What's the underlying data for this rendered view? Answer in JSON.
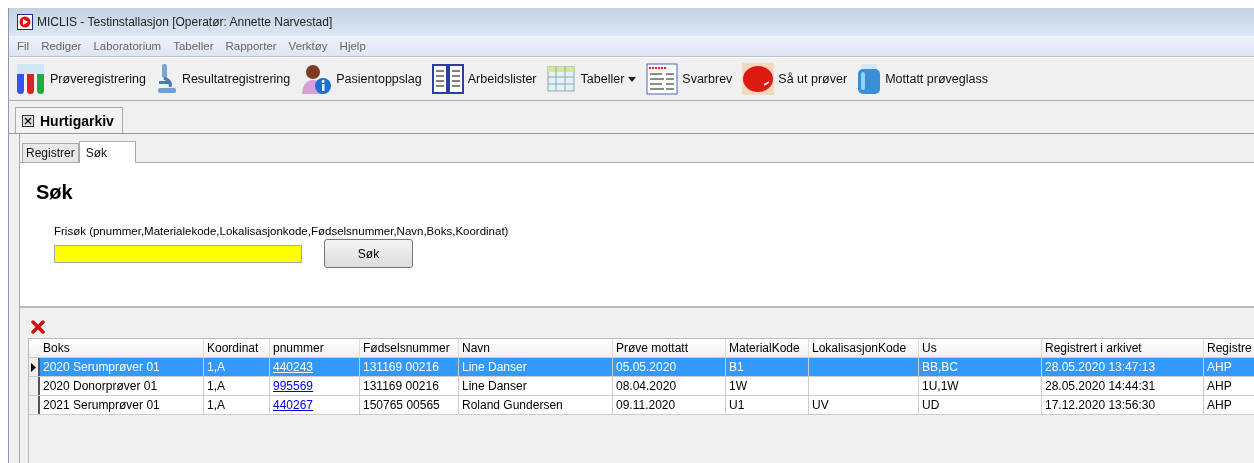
{
  "window": {
    "title": "MICLIS - Testinstallasjon [Operatør: Annette Narvestad]"
  },
  "menu": [
    "Fil",
    "Rediger",
    "Laboratorium",
    "Tabeller",
    "Rapporter",
    "Verktøy",
    "Hjelp"
  ],
  "toolbar": [
    {
      "kind": "tubes",
      "label": "Prøveregistrering"
    },
    {
      "kind": "microscope",
      "label": "Resultatregistrering"
    },
    {
      "kind": "patient",
      "label": "Pasientoppslag"
    },
    {
      "kind": "lists",
      "label": "Arbeidslister"
    },
    {
      "kind": "table",
      "label": "Tabeller",
      "dropdown": true
    },
    {
      "kind": "letter",
      "label": "Svarbrev"
    },
    {
      "kind": "dish",
      "label": "Så ut prøver"
    },
    {
      "kind": "jar",
      "label": "Mottatt prøveglass"
    }
  ],
  "document_tab": {
    "label": "Hurtigarkiv"
  },
  "tabs": [
    {
      "label": "Registrer",
      "selected": false
    },
    {
      "label": "Søk",
      "selected": true
    }
  ],
  "heading": "Søk",
  "search": {
    "label": "Frisøk (pnummer,Materialekode,Lokalisasjonkode,Fødselsnummer,Navn,Boks,Koordinat)",
    "button": "Søk"
  },
  "table": {
    "columns": [
      "Boks",
      "Koordinat",
      "pnummer",
      "Fødselsnummer",
      "Navn",
      "Prøve mottatt",
      "MaterialKode",
      "LokalisasjonKode",
      "Us",
      "Registrert i arkivet",
      "Registre"
    ],
    "rows": [
      {
        "selected": true,
        "cells": [
          "2020 Serumprøver 01",
          "1,A",
          "440243",
          "131169 00216",
          "Line Danser",
          "05.05.2020",
          "B1",
          "",
          "BB,BC",
          "28.05.2020 13:47:13",
          "AHP"
        ]
      },
      {
        "selected": false,
        "cells": [
          "2020 Donorprøver 01",
          "1,A",
          "995569",
          "131169 00216",
          "Line Danser",
          "08.04.2020",
          "1W",
          "",
          "1U,1W",
          "28.05.2020 14:44:31",
          "AHP"
        ]
      },
      {
        "selected": false,
        "cells": [
          "2021 Serumprøver 01",
          "1,A",
          "440267",
          "150765 00565",
          "Roland Gundersen",
          "09.11.2020",
          "U1",
          "UV",
          "UD",
          "17.12.2020 13:56:30",
          "AHP"
        ]
      }
    ]
  }
}
